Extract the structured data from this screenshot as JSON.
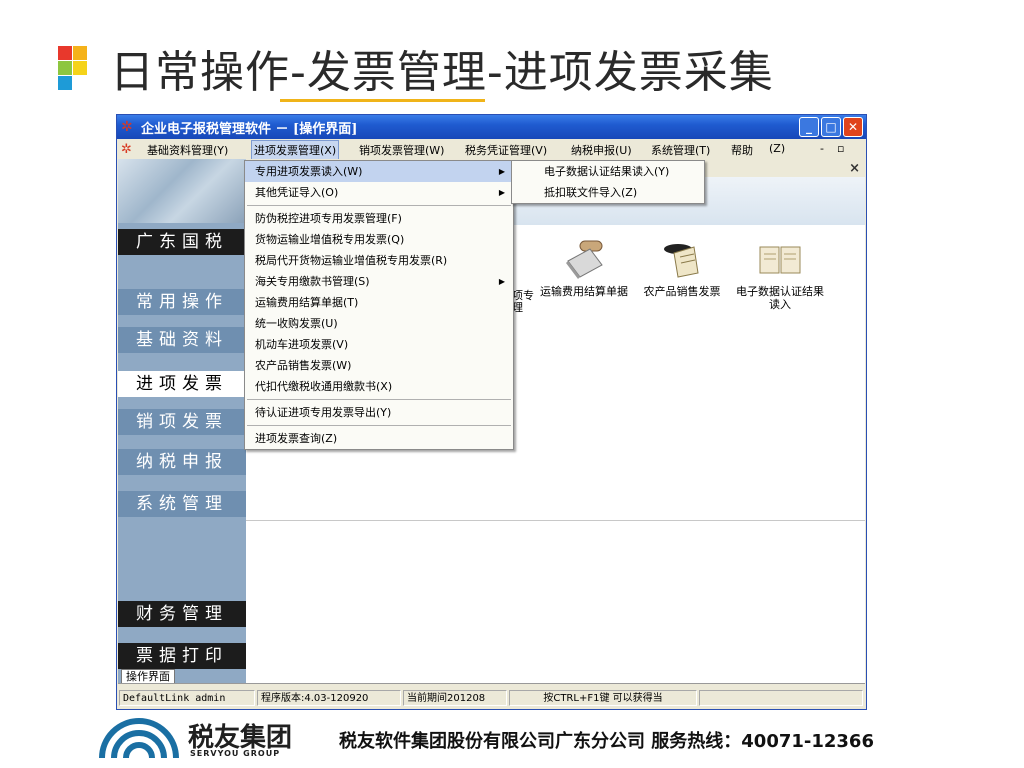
{
  "slide": {
    "title": "日常操作-发票管理-进项发票采集",
    "accent_color": "#f0b419"
  },
  "window": {
    "title": "企业电子报税管理软件 － [操作界面]",
    "minimize_icon": "minimize-icon",
    "maximize_icon": "maximize-icon",
    "close_icon": "close-icon"
  },
  "menubar": {
    "items": [
      {
        "label": "基础资料管理(Y)"
      },
      {
        "label": "进项发票管理(X)"
      },
      {
        "label": "销项发票管理(W)"
      },
      {
        "label": "税务凭证管理(V)"
      },
      {
        "label": "纳税申报(U)"
      },
      {
        "label": "系统管理(T)"
      },
      {
        "label": "帮助"
      },
      {
        "label": "(Z)"
      }
    ],
    "child_min": "-",
    "child_restore": "▫",
    "child_close": "×"
  },
  "leftnav": {
    "items": [
      {
        "label": "广东国税"
      },
      {
        "label": "常用操作"
      },
      {
        "label": "基础资料"
      },
      {
        "label": "进项发票"
      },
      {
        "label": "销项发票"
      },
      {
        "label": "纳税申报"
      },
      {
        "label": "系统管理"
      },
      {
        "label": "财务管理"
      },
      {
        "label": "票据打印"
      }
    ]
  },
  "content": {
    "partial_label_1": "项专",
    "partial_label_2": "理",
    "tiles": [
      {
        "label": "运输费用结算单据",
        "icon": "freight-bill-icon"
      },
      {
        "label": "农产品销售发票",
        "icon": "agri-invoice-icon"
      },
      {
        "label": "电子数据认证结果读入",
        "icon": "book-icon"
      }
    ]
  },
  "dropdown": {
    "items": [
      {
        "label": "专用进项发票读入(W)"
      },
      {
        "label": "其他凭证导入(O)"
      },
      {
        "label": "防伪税控进项专用发票管理(F)"
      },
      {
        "label": "货物运输业增值税专用发票(Q)"
      },
      {
        "label": "税局代开货物运输业增值税专用发票(R)"
      },
      {
        "label": "海关专用缴款书管理(S)"
      },
      {
        "label": "运输费用结算单据(T)"
      },
      {
        "label": "统一收购发票(U)"
      },
      {
        "label": "机动车进项发票(V)"
      },
      {
        "label": "农产品销售发票(W)"
      },
      {
        "label": "代扣代缴税收通用缴款书(X)"
      },
      {
        "label": "待认证进项专用发票导出(Y)"
      },
      {
        "label": "进项发票查询(Z)"
      }
    ]
  },
  "submenu": {
    "items": [
      {
        "label": "电子数据认证结果读入(Y)"
      },
      {
        "label": "抵扣联文件导入(Z)"
      }
    ]
  },
  "tab": {
    "label": "操作界面"
  },
  "status": {
    "link": "DefaultLink admin",
    "version": "程序版本:4.03-120920",
    "period": "当前期间201208",
    "hint": "按CTRL+F1键 可以获得当"
  },
  "footer": {
    "brand_cn": "税友集团",
    "brand_en": "SERVYOU GROUP",
    "text": "税友软件集团股份有限公司广东分公司  服务热线：40071-12366"
  }
}
